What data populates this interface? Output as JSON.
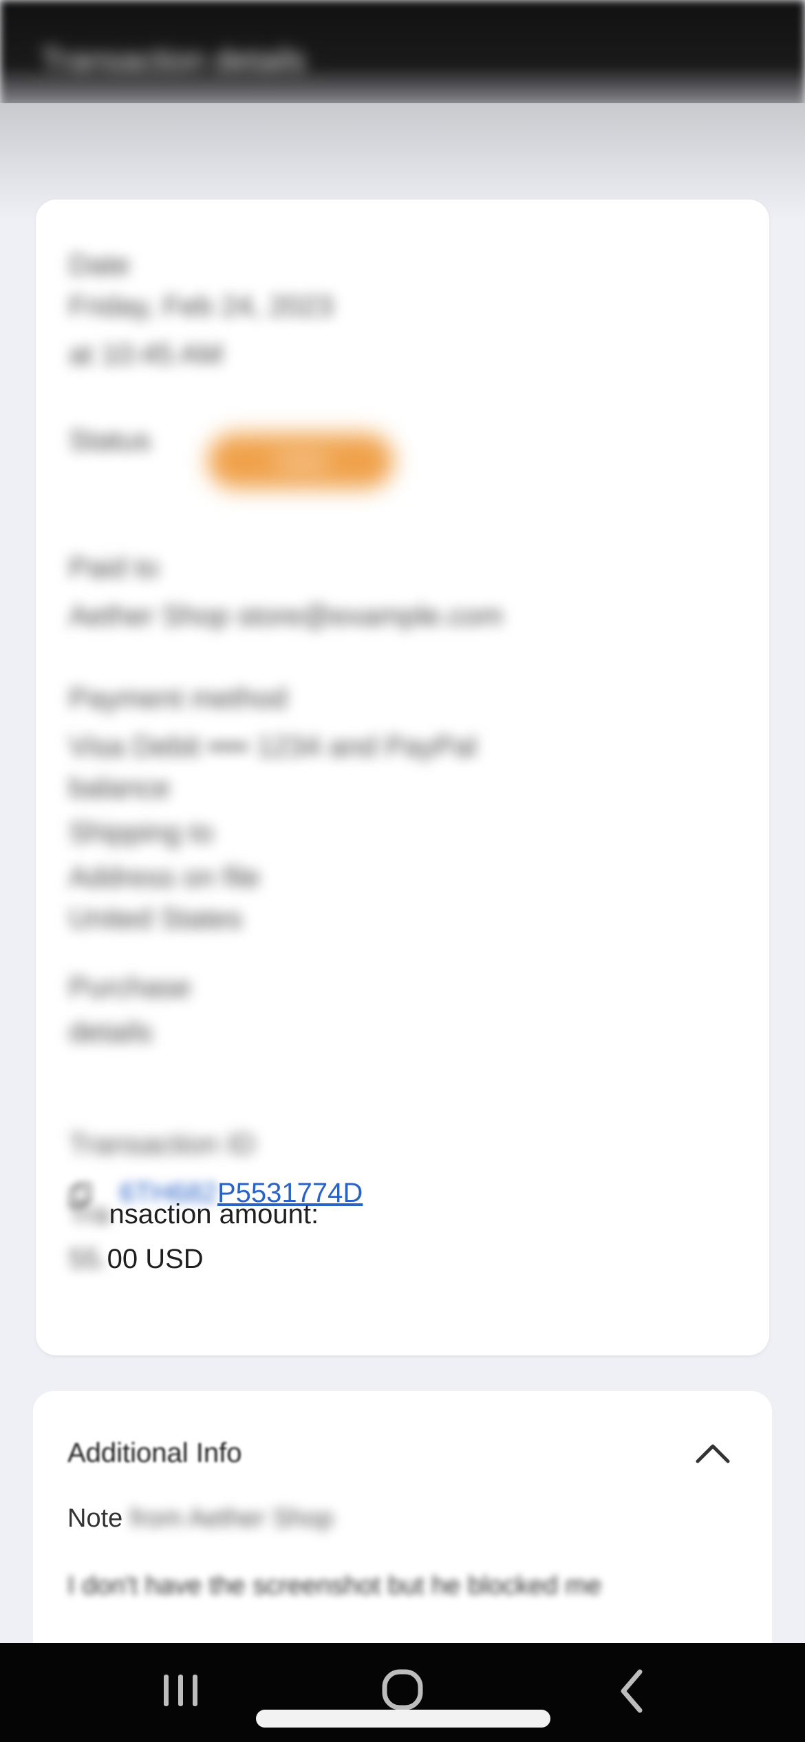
{
  "header": {
    "title": "Transaction details"
  },
  "details": {
    "line_1": "Date",
    "line_2": "Friday, Feb 24, 2023",
    "line_3": "at 10:45 AM",
    "status_label": "Status",
    "status_value": "Held",
    "paid_to_label": "Paid to",
    "paid_to_value": "Aether Shop store@example.com",
    "line_7": "Payment method",
    "line_8": "Visa Debit •••• 1234 and PayPal",
    "line_9": "balance",
    "line_10": "Shipping to",
    "line_11": "Address on file",
    "line_12": "United States",
    "line_13": "Purchase",
    "line_14": "details",
    "txn_id_label": "Transaction ID",
    "txn_id_prefix": "6TH682",
    "txn_id_suffix": "P5531774D",
    "amount_label_prefix": "Tra",
    "amount_label_suffix": "nsaction amount:",
    "amount_prefix": "55.",
    "amount_suffix": "00 USD"
  },
  "additional_info": {
    "title": "Additional Info",
    "note_prefix": "Note",
    "note_from": "from Aether Shop",
    "note_text": "I don't have the screenshot but he blocked me"
  },
  "colors": {
    "link": "#2a63c8",
    "status_pill": "#f0a24b",
    "background": "#eef0f5"
  },
  "icons": {
    "collapse": "chevron-up-icon",
    "copy": "copy-icon",
    "nav_recent": "recent-apps-icon",
    "nav_home": "home-icon",
    "nav_back": "back-icon"
  }
}
